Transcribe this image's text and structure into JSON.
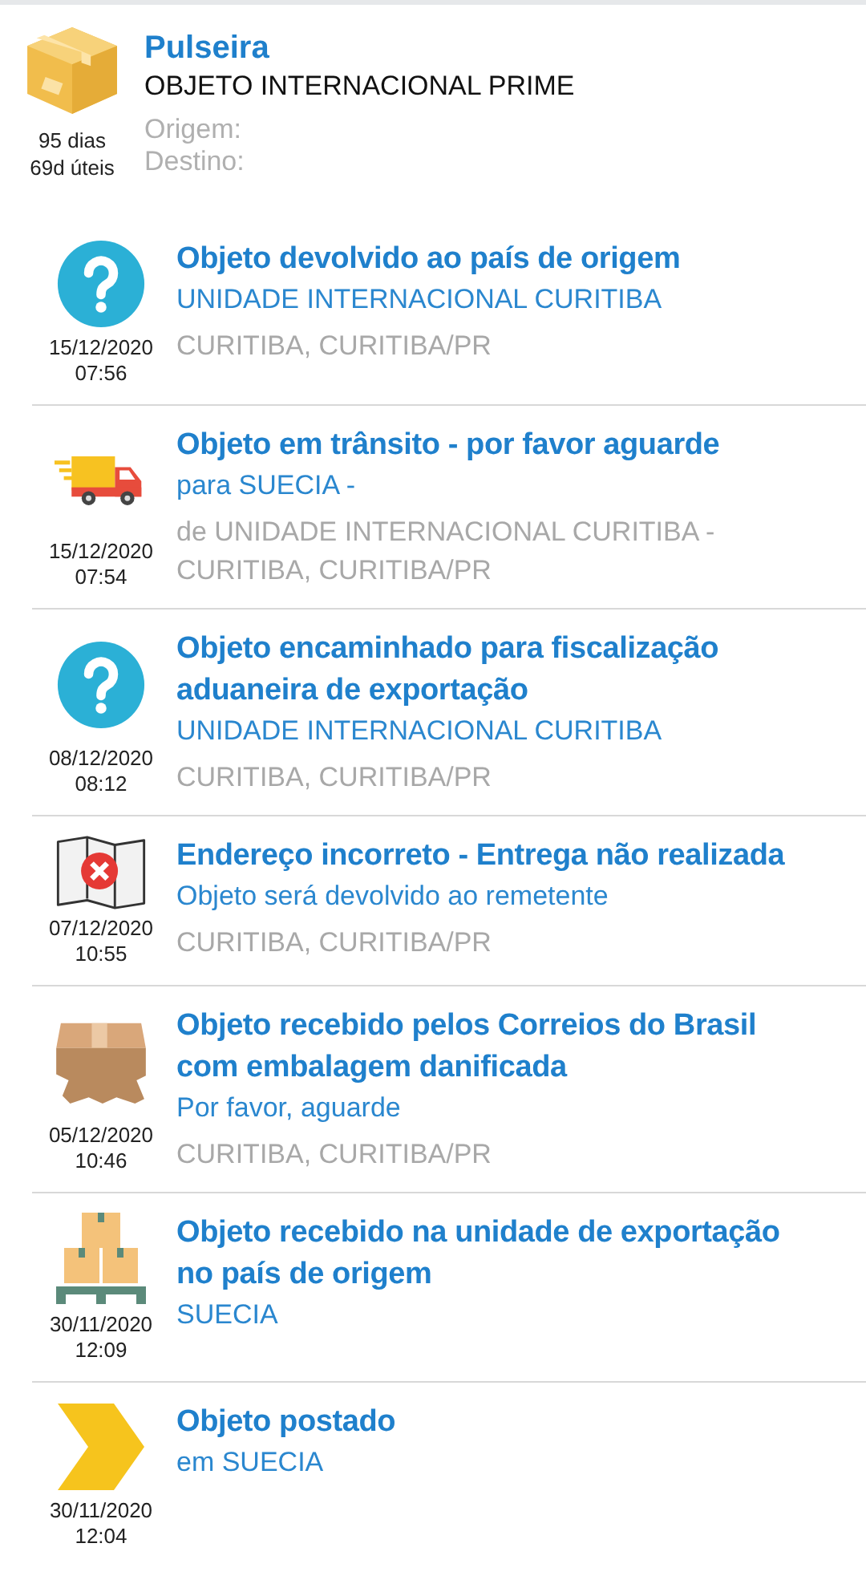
{
  "header": {
    "title": "Pulseira",
    "category": "OBJETO INTERNACIONAL PRIME",
    "days": "95 dias",
    "business_days": "69d úteis",
    "origin_label": "Origem:",
    "destination_label": "Destino:"
  },
  "events": [
    {
      "kind": "question",
      "title": "Objeto devolvido ao país de origem",
      "subtitle": "UNIDADE INTERNACIONAL CURITIBA",
      "location": [
        "CURITIBA, CURITIBA/PR"
      ],
      "date": "15/12/2020",
      "time": "07:56"
    },
    {
      "kind": "truck",
      "title": "Objeto em trânsito - por favor aguarde",
      "subtitle": "para SUECIA -",
      "location": [
        "de UNIDADE INTERNACIONAL CURITIBA -",
        "CURITIBA, CURITIBA/PR"
      ],
      "date": "15/12/2020",
      "time": "07:54"
    },
    {
      "kind": "question",
      "title": "Objeto encaminhado para fiscalização aduaneira de exportação",
      "subtitle": "UNIDADE INTERNACIONAL CURITIBA",
      "location": [
        "CURITIBA, CURITIBA/PR"
      ],
      "date": "08/12/2020",
      "time": "08:12"
    },
    {
      "kind": "map-error",
      "title": "Endereço incorreto - Entrega não realizada",
      "subtitle": "Objeto será devolvido ao remetente",
      "location": [
        "CURITIBA, CURITIBA/PR"
      ],
      "date": "07/12/2020",
      "time": "10:55"
    },
    {
      "kind": "damaged-box",
      "title": "Objeto recebido pelos Correios do Brasil com embalagem danificada",
      "subtitle": "Por favor, aguarde",
      "location": [
        "CURITIBA, CURITIBA/PR"
      ],
      "date": "05/12/2020",
      "time": "10:46"
    },
    {
      "kind": "pallet",
      "title": "Objeto recebido na unidade de exportação no país de origem",
      "subtitle": "SUECIA",
      "date": "30/11/2020",
      "time": "12:09"
    },
    {
      "kind": "chevron",
      "title": "Objeto postado",
      "subtitle": "em SUECIA",
      "date": "30/11/2020",
      "time": "12:04"
    }
  ]
}
